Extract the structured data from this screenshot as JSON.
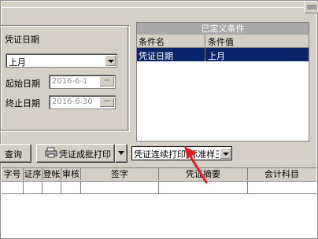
{
  "filters": {
    "voucher_date_label": "凭证日期",
    "period_value": "上月",
    "start_date_label": "起始日期",
    "start_date_value": "2016-6-1",
    "end_date_label": "终止日期",
    "end_date_value": "2016-6-30",
    "ellipsis": "···"
  },
  "conditions": {
    "title": "已定义条件",
    "headers": [
      "条件名",
      "条件值"
    ],
    "rows": [
      {
        "name": "凭证日期",
        "value": "上月"
      }
    ]
  },
  "toolbar": {
    "query_label": "查询",
    "batch_print_label": "凭证成批打印",
    "continuous_print_value": "凭证连续打印[标准样王"
  },
  "grid": {
    "headers": [
      "字号",
      "证序",
      "登帐",
      "审核",
      "签字",
      "凭证摘要",
      "会计科目"
    ]
  },
  "colors": {
    "panel": "#d4d0c8",
    "selection": "#0a246a",
    "title_bar": "#a9a9a9",
    "arrow": "#e02020"
  }
}
